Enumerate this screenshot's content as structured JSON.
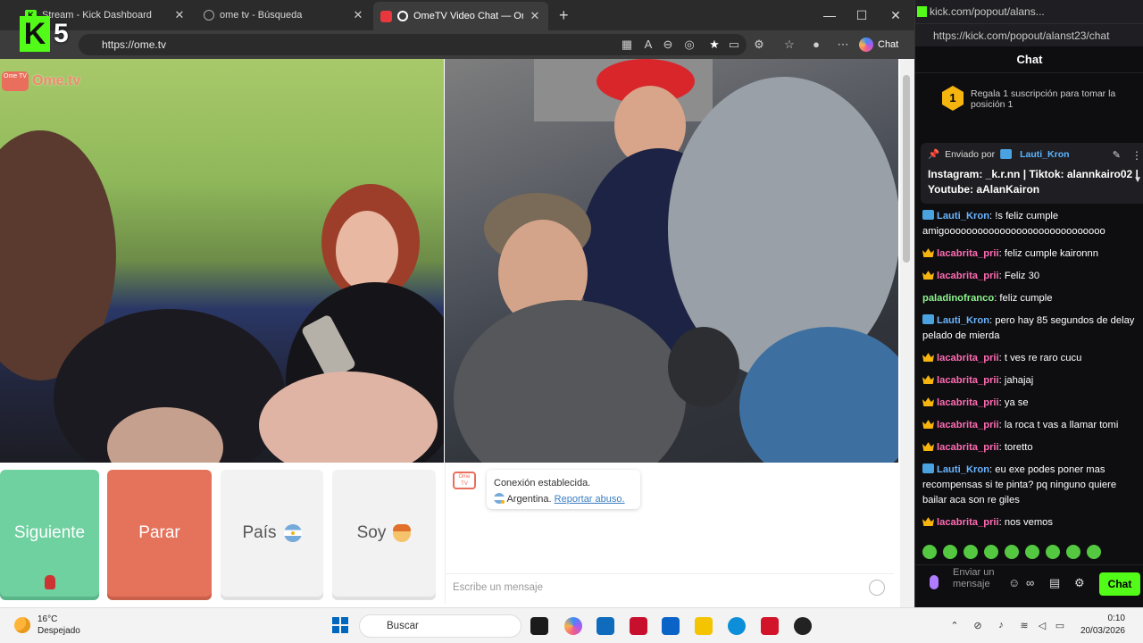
{
  "browser": {
    "tabs": [
      {
        "title": "Stream - Kick Dashboard",
        "close": "✕"
      },
      {
        "title": "ome tv - Búsqueda",
        "close": "✕"
      },
      {
        "title": "OmeTV Video Chat — Omegl",
        "close": "✕"
      }
    ],
    "new_tab": "+",
    "url": "https://ome.tv",
    "chat_button": "Chat",
    "overlay_number": "5",
    "window_controls": {
      "minimize": "—",
      "maximize": "☐",
      "close": "✕"
    }
  },
  "ometv": {
    "logo_badge": "Ome TV",
    "logo_text": "Ome.tv",
    "buttons": {
      "next": "Siguiente",
      "stop": "Parar",
      "country": "País",
      "soy": "Soy"
    },
    "system_message": {
      "line1": "Conexión establecida.",
      "country": "Argentina.",
      "report_link": "Reportar abuso."
    },
    "message_placeholder": "Escribe un mensaje"
  },
  "kick": {
    "window_url": "kick.com/popout/alans...",
    "url": "https://kick.com/popout/alanst23/chat",
    "header": "Chat",
    "gift": {
      "rank": "1",
      "text": "Regala 1 suscripción para tomar la posición 1"
    },
    "pinned": {
      "sent_by": "Enviado por",
      "user": "Lauti_Kron",
      "text": "Instagram: _k.r.nn | Tiktok: alannkairo02 | Youtube: aAlanKairon"
    },
    "messages": [
      {
        "user": "Lauti_Kron",
        "badge": "sub",
        "color": "blue",
        "text": "!s feliz cumple amigooooooooooooooooooooooooooooo"
      },
      {
        "user": "lacabrita_prii",
        "badge": "crown",
        "color": "pink",
        "text": "feliz cumple kaironnn"
      },
      {
        "user": "lacabrita_prii",
        "badge": "crown",
        "color": "pink",
        "text": "Feliz 30"
      },
      {
        "user": "paladinofranco",
        "badge": "",
        "color": "green",
        "text": "feliz cumple"
      },
      {
        "user": "Lauti_Kron",
        "badge": "sub",
        "color": "blue",
        "text": "pero hay 85 segundos de delay pelado de mierda"
      },
      {
        "user": "lacabrita_prii",
        "badge": "crown",
        "color": "pink",
        "text": "t ves re raro cucu"
      },
      {
        "user": "lacabrita_prii",
        "badge": "crown",
        "color": "pink",
        "text": "jahajaj"
      },
      {
        "user": "lacabrita_prii",
        "badge": "crown",
        "color": "pink",
        "text": "ya se"
      },
      {
        "user": "lacabrita_prii",
        "badge": "crown",
        "color": "pink",
        "text": "la roca t vas a llamar tomi"
      },
      {
        "user": "lacabrita_prii",
        "badge": "crown",
        "color": "pink",
        "text": "toretto"
      },
      {
        "user": "Lauti_Kron",
        "badge": "sub",
        "color": "blue",
        "text": "eu exe podes poner mas recompensas si te pinta? pq ninguno quiere bailar aca son re giles"
      },
      {
        "user": "lacabrita_prii",
        "badge": "crown",
        "color": "pink",
        "text": "nos vemos"
      }
    ],
    "send_label": "Enviar un mensaje",
    "chat_button": "Chat"
  },
  "taskbar": {
    "weather_temp": "16°C",
    "weather_desc": "Despejado",
    "search_placeholder": "Buscar",
    "time": "0:10",
    "date": "20/03/2026"
  },
  "colors": {
    "kick_green": "#53fc18",
    "ometv_next": "#6fd0a0",
    "ometv_stop": "#e5735c"
  }
}
